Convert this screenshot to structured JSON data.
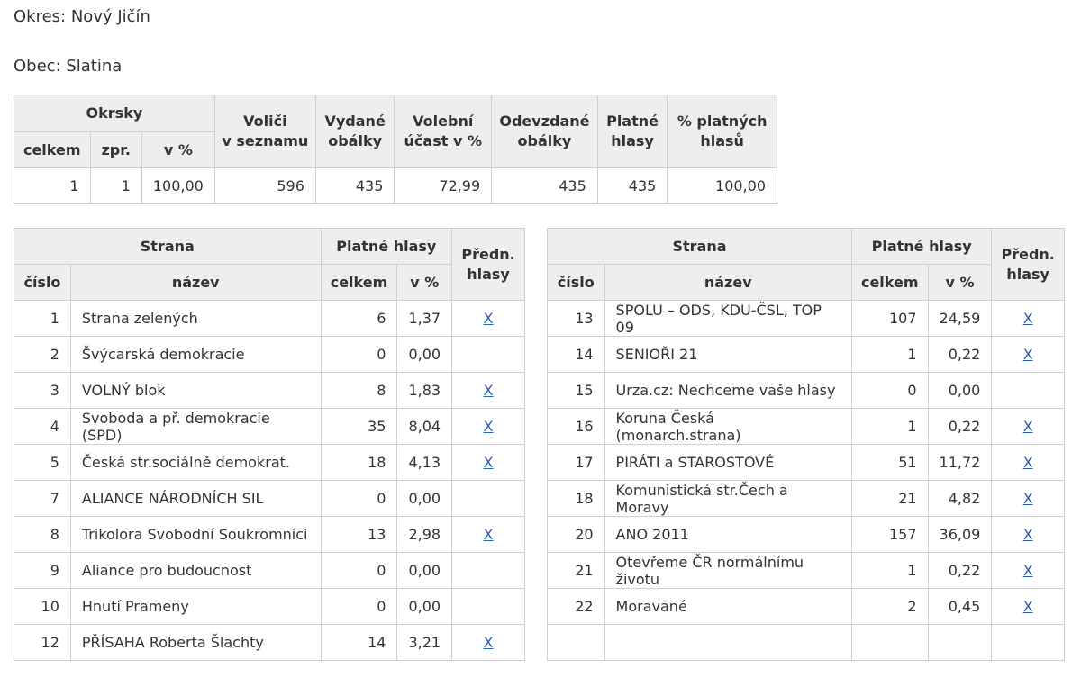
{
  "okres": "Okres: Nový Jičín",
  "obec": "Obec: Slatina",
  "summary": {
    "headers": {
      "okrsky": "Okrsky",
      "celkem": "celkem",
      "zpr": "zpr.",
      "v_pct": "v %",
      "volici_l1": "Voliči",
      "volici_l2": "v seznamu",
      "vydane_l1": "Vydané",
      "vydane_l2": "obálky",
      "ucast_l1": "Volební",
      "ucast_l2": "účast v %",
      "odevzdane_l1": "Odevzdané",
      "odevzdane_l2": "obálky",
      "platne_l1": "Platné",
      "platne_l2": "hlasy",
      "pct_platnych_l1": "% platných",
      "pct_platnych_l2": "hlasů"
    },
    "values": [
      "1",
      "1",
      "100,00",
      "596",
      "435",
      "72,99",
      "435",
      "435",
      "100,00"
    ]
  },
  "party_headers": {
    "strana": "Strana",
    "platne_hlasy": "Platné hlasy",
    "predn_l1": "Předn.",
    "predn_l2": "hlasy",
    "cislo": "číslo",
    "nazev": "název",
    "celkem": "celkem",
    "v_pct": "v %",
    "link_text": "X"
  },
  "left_rows": [
    {
      "cislo": "1",
      "nazev": "Strana zelených",
      "celkem": "6",
      "pct": "1,37",
      "link": true
    },
    {
      "cislo": "2",
      "nazev": "Švýcarská demokracie",
      "celkem": "0",
      "pct": "0,00",
      "link": false
    },
    {
      "cislo": "3",
      "nazev": "VOLNÝ blok",
      "celkem": "8",
      "pct": "1,83",
      "link": true
    },
    {
      "cislo": "4",
      "nazev": "Svoboda a př. demokracie (SPD)",
      "celkem": "35",
      "pct": "8,04",
      "link": true
    },
    {
      "cislo": "5",
      "nazev": "Česká str.sociálně demokrat.",
      "celkem": "18",
      "pct": "4,13",
      "link": true
    },
    {
      "cislo": "7",
      "nazev": "ALIANCE NÁRODNÍCH SIL",
      "celkem": "0",
      "pct": "0,00",
      "link": false
    },
    {
      "cislo": "8",
      "nazev": "Trikolora Svobodní Soukromníci",
      "celkem": "13",
      "pct": "2,98",
      "link": true
    },
    {
      "cislo": "9",
      "nazev": "Aliance pro budoucnost",
      "celkem": "0",
      "pct": "0,00",
      "link": false
    },
    {
      "cislo": "10",
      "nazev": "Hnutí Prameny",
      "celkem": "0",
      "pct": "0,00",
      "link": false
    },
    {
      "cislo": "12",
      "nazev": "PŘÍSAHA Roberta Šlachty",
      "celkem": "14",
      "pct": "3,21",
      "link": true
    }
  ],
  "right_rows": [
    {
      "cislo": "13",
      "nazev": "SPOLU – ODS, KDU-ČSL, TOP 09",
      "celkem": "107",
      "pct": "24,59",
      "link": true
    },
    {
      "cislo": "14",
      "nazev": "SENIOŘI 21",
      "celkem": "1",
      "pct": "0,22",
      "link": true
    },
    {
      "cislo": "15",
      "nazev": "Urza.cz: Nechceme vaše hlasy",
      "celkem": "0",
      "pct": "0,00",
      "link": false
    },
    {
      "cislo": "16",
      "nazev": "Koruna Česká (monarch.strana)",
      "celkem": "1",
      "pct": "0,22",
      "link": true
    },
    {
      "cislo": "17",
      "nazev": "PIRÁTI a STAROSTOVÉ",
      "celkem": "51",
      "pct": "11,72",
      "link": true
    },
    {
      "cislo": "18",
      "nazev": "Komunistická str.Čech a Moravy",
      "celkem": "21",
      "pct": "4,82",
      "link": true
    },
    {
      "cislo": "20",
      "nazev": "ANO 2011",
      "celkem": "157",
      "pct": "36,09",
      "link": true
    },
    {
      "cislo": "21",
      "nazev": "Otevřeme ČR normálnímu životu",
      "celkem": "1",
      "pct": "0,22",
      "link": true
    },
    {
      "cislo": "22",
      "nazev": "Moravané",
      "celkem": "2",
      "pct": "0,45",
      "link": true
    },
    {
      "cislo": "",
      "nazev": "",
      "celkem": "",
      "pct": "",
      "link": false
    }
  ]
}
